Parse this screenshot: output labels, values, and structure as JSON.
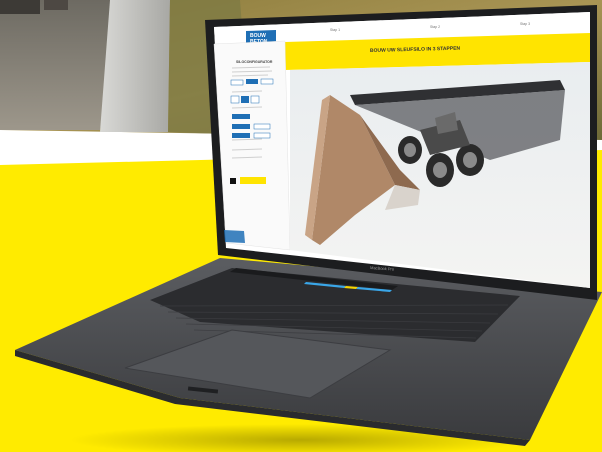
{
  "scene": {
    "colors": {
      "yellow": "#ffeb00",
      "laptop_body": "#4a4c50",
      "laptop_dark": "#2b2c2f",
      "screen_bg": "#ffffff",
      "brand_blue": "#1f6fb5",
      "banner_yellow": "#ffe400",
      "touchbar_blue": "#3aa6e8",
      "touchbar_yellow": "#f5d400"
    },
    "laptop": {
      "model_label": "MacBook Pro"
    },
    "screen": {
      "logo_line1": "BOUW",
      "logo_line2": "BETON",
      "banner_title": "BOUW UW SLEUFSILO IN 3 STAPPEN",
      "steps": [
        "Stap 1",
        "Stap 2",
        "Stap 3"
      ],
      "sidebar_header": "SILOCONFIGURATOR",
      "buttons": [
        "Kies",
        "Kies",
        "Kies"
      ]
    }
  }
}
